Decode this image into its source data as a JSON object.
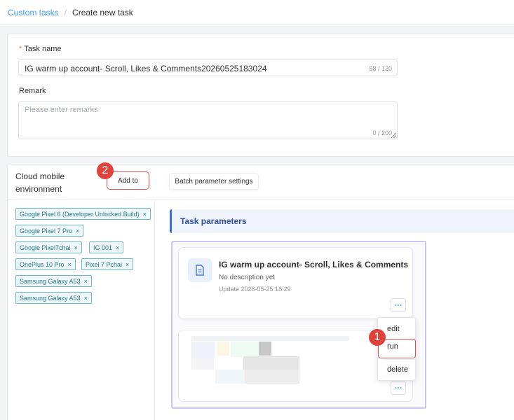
{
  "breadcrumb": {
    "parent": "Custom tasks",
    "separator": "/",
    "current": "Create new task"
  },
  "form": {
    "task_name_label": "Task name",
    "required_mark": "*",
    "task_name_value": "IG warm up account- Scroll, Likes & Comments20260525183024",
    "task_name_count": "58 / 120",
    "remark_label": "Remark",
    "remark_placeholder": "Please enter remarks",
    "remark_count": "0 / 200"
  },
  "env": {
    "title": "Cloud mobile environment",
    "add_button": "Add to",
    "batch_button": "Batch parameter settings",
    "tags": [
      "Google Pixel 6 (Developer Unlocked Build)",
      "Google Pixel 7 Pro",
      "Google Pixel7chai",
      "IG 001",
      "OnePlus 10 Pro",
      "Pixel 7 Pchai",
      "Samsung Galaxy A53",
      "Samsung Galaxy A53"
    ],
    "tag_close": "×"
  },
  "params": {
    "title": "Task parameters",
    "task": {
      "name": "IG warm up account- Scroll, Likes & Comments",
      "description": "No description yet",
      "updated": "Update 2026-05-25 18:29",
      "more": "···"
    },
    "menu": [
      "edit",
      "run",
      "delete"
    ]
  },
  "annotations": {
    "step1": "1",
    "step2": "2",
    "color": "#e0413b"
  }
}
